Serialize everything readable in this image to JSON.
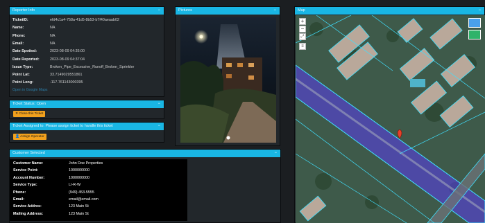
{
  "reporter": {
    "header": "Reporter Info",
    "collapse": "−",
    "fields": [
      {
        "label": "TicketID:",
        "value": "efd4c1a4-758a-41d5-8b53-b7f40aeaab02"
      },
      {
        "label": "Name:",
        "value": "NA"
      },
      {
        "label": "Phone:",
        "value": "NA"
      },
      {
        "label": "Email:",
        "value": "NA"
      },
      {
        "label": "Date Spotted:",
        "value": "2023-08-09 04:35:00"
      },
      {
        "label": "Date Reported:",
        "value": "2023-08-09 04:37:04"
      },
      {
        "label": "Issue Type:",
        "value": "Broken_Pipe_Excessive_Runoff_Broken_Sprinkler"
      },
      {
        "label": "Point Lat:",
        "value": "33.7149029551861"
      },
      {
        "label": "Point Long:",
        "value": "-117.761143000395"
      }
    ],
    "google_maps_link": "Open in Google Maps"
  },
  "ticket_status": {
    "header": "Ticket Status: Open",
    "collapse": "−",
    "close_button": "Close this Ticket"
  },
  "assignment": {
    "header": "Ticket Assigned to: Please assign ticket to handle this ticket",
    "collapse": "−",
    "assign_button": "Assign Operator"
  },
  "customer": {
    "header": "Customer Selected",
    "collapse": "−",
    "fields": [
      {
        "label": "Customer Name:",
        "value": "John Doe Properties"
      },
      {
        "label": "Service Point:",
        "value": "1000000000"
      },
      {
        "label": "Account Number:",
        "value": "1000000000"
      },
      {
        "label": "Service Type:",
        "value": "LI-R-W"
      },
      {
        "label": "Phone:",
        "value": "(949) 453-5555"
      },
      {
        "label": "Email:",
        "value": "email@email.com"
      },
      {
        "label": "Service Addres:",
        "value": "123 Main St"
      },
      {
        "label": "Mailing Address:",
        "value": "123 Main St"
      }
    ]
  },
  "pictures": {
    "header": "Pictures",
    "collapse": "−"
  },
  "map": {
    "header": "Map",
    "collapse": "−",
    "zoom_in": "+",
    "zoom_out": "−"
  },
  "colors": {
    "header_bg": "#19b6e4",
    "panel_bg": "#22272b",
    "page_bg": "#1b1e21",
    "button": "#f2a11d",
    "link": "#2b7ea8",
    "map_highlight": "#5a3df0"
  }
}
